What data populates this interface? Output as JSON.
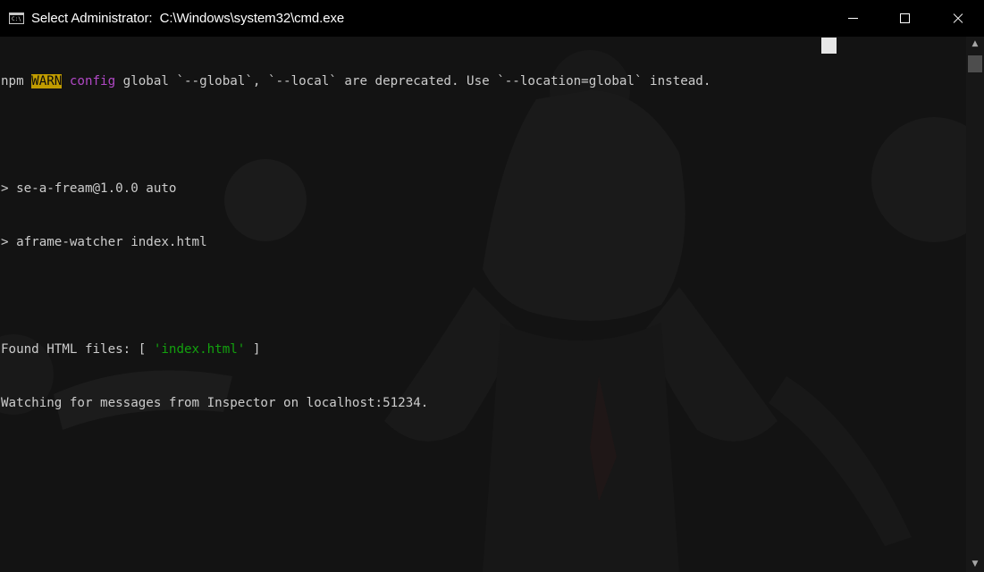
{
  "window": {
    "title": "Select Administrator:  C:\\Windows\\system32\\cmd.exe",
    "icon": "cmd-icon",
    "icon_text": "C:\\",
    "controls": [
      "minimize-icon",
      "maximize-icon",
      "close-icon"
    ]
  },
  "console": {
    "line1": {
      "prefix": "npm ",
      "warn": "WARN",
      "space": " ",
      "config": "config",
      "rest": " global `--global`, `--local` are deprecated. Use `--location=global` instead."
    },
    "line2": "",
    "line3": "> se-a-fream@1.0.0 auto",
    "line4": "> aframe-watcher index.html",
    "line5": "",
    "line6": {
      "prefix": "Found HTML files: [ ",
      "file": "'index.html'",
      "suffix": " ]"
    },
    "line7": "Watching for messages from Inspector on localhost:51234."
  },
  "scrollbar": {
    "up": "▲",
    "down": "▼",
    "position": 0.0
  },
  "colors": {
    "warn_bg": "#c19c00",
    "config": "#b148c6",
    "string": "#13a10e",
    "text": "#cccccc",
    "background": "#131313"
  }
}
